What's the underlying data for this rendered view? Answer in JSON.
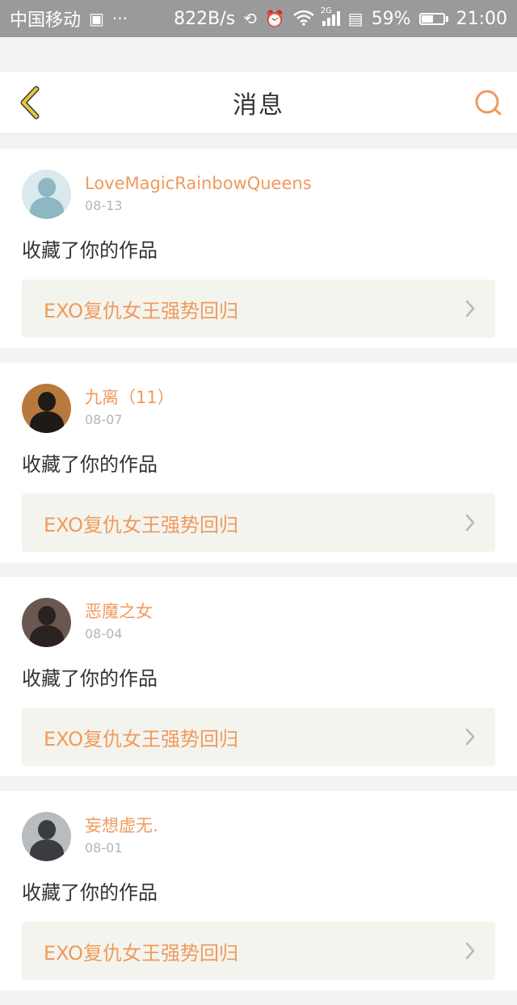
{
  "status_bar": {
    "carrier": "中国移动",
    "speed": "822B/s",
    "signal_label": "2G",
    "battery": "59%",
    "battery_level": 0.59,
    "time": "21:00"
  },
  "header": {
    "title": "消息"
  },
  "notifications": [
    {
      "username": "LoveMagicRainbowQueens",
      "date": "08-13",
      "action": "收藏了你的作品",
      "work_title": "EXO复仇女王强势回归",
      "avatar_colors": [
        "#d9e9ec",
        "#8fb6c3"
      ]
    },
    {
      "username": "九离（11）",
      "date": "08-07",
      "action": "收藏了你的作品",
      "work_title": "EXO复仇女王强势回归",
      "avatar_colors": [
        "#b87a3c",
        "#1e1a18"
      ]
    },
    {
      "username": "恶魔之女",
      "date": "08-04",
      "action": "收藏了你的作品",
      "work_title": "EXO复仇女王强势回归",
      "avatar_colors": [
        "#6a5850",
        "#2a2220"
      ]
    },
    {
      "username": "妄想虚无.",
      "date": "08-01",
      "action": "收藏了你的作品",
      "work_title": "EXO复仇女王强势回归",
      "avatar_colors": [
        "#b9bcbe",
        "#3a3c40"
      ]
    }
  ],
  "colors": {
    "accent": "#f09a5c",
    "back_icon": "#e8c63a",
    "card_link_bg": "#f4f4ee"
  }
}
